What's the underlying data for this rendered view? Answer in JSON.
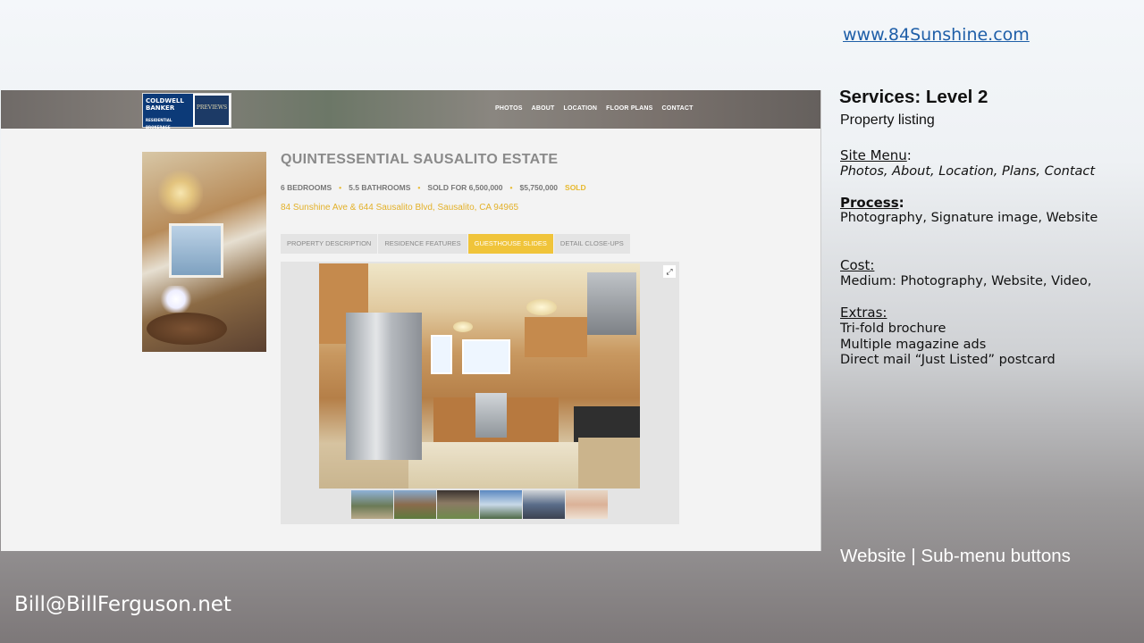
{
  "slide": {
    "url": "www.84Sunshine.com",
    "services_title": "Services:  Level 2",
    "services_sub": "Property listing",
    "site_menu_label": "Site Menu",
    "site_menu_colon": ":",
    "site_menu_items": "Photos, About, Location, Plans, Contact",
    "process_label": "Process",
    "process_colon": ":",
    "process_text": "Photography, Signature image, Website",
    "cost_label": "Cost:",
    "cost_text": "Medium: Photography, Website, Video,",
    "extras_label": "Extras:",
    "extras": [
      "Tri-fold brochure",
      "Multiple magazine ads",
      "Direct mail “Just Listed” postcard"
    ],
    "caption": "Website  |  Sub-menu buttons",
    "email": "Bill@BillFerguson.net"
  },
  "website": {
    "logo": {
      "brand": "COLDWELL BANKER",
      "brand_sub": "RESIDENTIAL BROKERAGE",
      "previews": "PREVIEWS"
    },
    "nav": [
      "PHOTOS",
      "ABOUT",
      "LOCATION",
      "FLOOR PLANS",
      "CONTACT"
    ],
    "title": "QUINTESSENTIAL SAUSALITO ESTATE",
    "facts": {
      "bedrooms": "6 BEDROOMS",
      "bathrooms": "5.5 BATHROOMS",
      "sold_for": "SOLD FOR 6,500,000",
      "list_price": "$5,750,000",
      "status": "SOLD"
    },
    "address": "84 Sunshine Ave & 644 Sausalito Blvd, Sausalito, CA 94965",
    "tabs": [
      {
        "label": "PROPERTY DESCRIPTION",
        "active": false
      },
      {
        "label": "RESIDENCE FEATURES",
        "active": false
      },
      {
        "label": "GUESTHOUSE SLIDES",
        "active": true
      },
      {
        "label": "DETAIL CLOSE-UPS",
        "active": false
      }
    ],
    "expand_icon": "expand-icon",
    "accent_color": "#f0c43a"
  }
}
